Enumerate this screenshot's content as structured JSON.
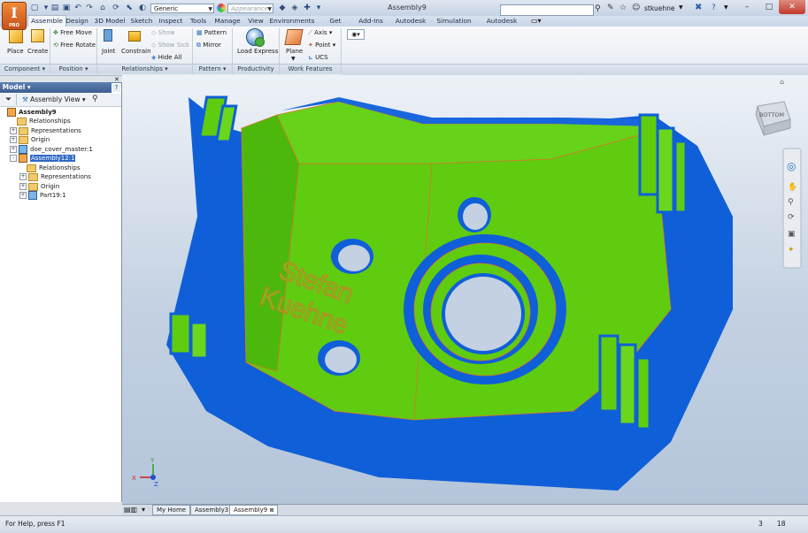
{
  "app": {
    "logo_letter": "I",
    "logo_sub": "PRO"
  },
  "titlebar": {
    "material_combo": "Generic",
    "appearance_combo": "Appearance",
    "document_title": "Assembly9",
    "search_placeholder": "",
    "username": "stkuehne"
  },
  "ribbon": {
    "tabs": [
      "Assemble",
      "Design",
      "3D Model",
      "Sketch",
      "Inspect",
      "Tools",
      "Manage",
      "View",
      "Environments",
      "Get Started",
      "Add-Ins",
      "Autodesk 360",
      "Simulation",
      "Autodesk Nastran"
    ],
    "active_tab": "Assemble",
    "component": {
      "place": "Place",
      "create": "Create",
      "panel": "Component"
    },
    "position": {
      "free_move": "Free Move",
      "free_rotate": "Free Rotate",
      "panel": "Position"
    },
    "relationships": {
      "joint": "Joint",
      "constrain": "Constrain",
      "show": "Show",
      "show_sick": "Show Sick",
      "hide_all": "Hide All",
      "panel": "Relationships"
    },
    "pattern": {
      "pattern": "Pattern",
      "mirror": "Mirror",
      "panel": "Pattern"
    },
    "productivity": {
      "load_express": "Load Express",
      "panel": "Productivity"
    },
    "work_features": {
      "plane": "Plane",
      "axis": "Axis",
      "point": "Point",
      "ucs": "UCS",
      "panel": "Work Features"
    }
  },
  "browser": {
    "title": "Model",
    "view_combo": "Assembly View",
    "tree": [
      {
        "label": "Assembly9",
        "icon": "assembly",
        "level": 0,
        "bold": true
      },
      {
        "label": "Relationships",
        "icon": "folder",
        "level": 1
      },
      {
        "label": "Representations",
        "icon": "folder",
        "level": 1,
        "expander": "+"
      },
      {
        "label": "Origin",
        "icon": "folder",
        "level": 1,
        "expander": "+"
      },
      {
        "label": "doe_cover_master:1",
        "icon": "part",
        "level": 1,
        "expander": "+"
      },
      {
        "label": "Assembly12:1",
        "icon": "assembly",
        "level": 1,
        "expander": "-",
        "selected": true
      },
      {
        "label": "Relationships",
        "icon": "folder",
        "level": 2
      },
      {
        "label": "Representations",
        "icon": "folder",
        "level": 2,
        "expander": "+"
      },
      {
        "label": "Origin",
        "icon": "folder",
        "level": 2,
        "expander": "+"
      },
      {
        "label": "Part19:1",
        "icon": "part",
        "level": 2,
        "expander": "+"
      }
    ]
  },
  "viewport": {
    "viewcube_label": "BOTTOM",
    "engraving_line1": "Stefan",
    "engraving_line2": "Kuehne",
    "axis_x": "X",
    "axis_y": "Y",
    "axis_z": "Z",
    "colors": {
      "green": "#5fcc10",
      "blue": "#0f5fd8",
      "outline": "#d6762a"
    }
  },
  "document_tabs": [
    "My Home",
    "Assembly3",
    "Assembly9"
  ],
  "status": {
    "help": "For Help, press F1",
    "count1": "3",
    "count2": "18"
  }
}
